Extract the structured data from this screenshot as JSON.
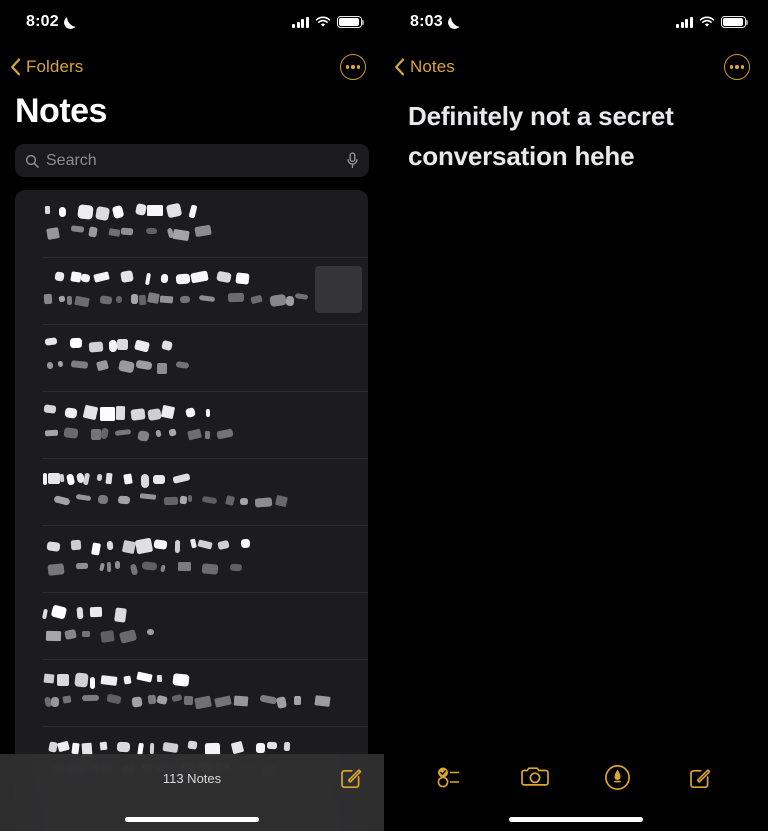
{
  "accent_color": "#dba530",
  "background_color": "#000000",
  "card_color": "#1c1c1e",
  "left_screen": {
    "status": {
      "time": "8:02",
      "moon_icon": "crescent-moon-icon",
      "signal_icon": "cellular-bars-icon",
      "wifi_icon": "wifi-icon",
      "battery_icon": "battery-full-icon"
    },
    "nav": {
      "back_label": "Folders",
      "back_icon": "chevron-left-icon",
      "more_icon": "ellipsis-circle-icon"
    },
    "title": "Notes",
    "search": {
      "placeholder": "Search",
      "icon": "magnifier-icon",
      "mic_icon": "microphone-icon"
    },
    "notes": [
      {
        "title_redacted": true,
        "preview_redacted": true,
        "has_thumbnail": false
      },
      {
        "title_redacted": true,
        "preview_redacted": true,
        "has_thumbnail": true
      },
      {
        "title_redacted": true,
        "preview_redacted": true,
        "has_thumbnail": false
      },
      {
        "title_redacted": true,
        "preview_redacted": true,
        "has_thumbnail": false
      },
      {
        "title_redacted": true,
        "preview_redacted": true,
        "has_thumbnail": false
      },
      {
        "title_redacted": true,
        "preview_redacted": true,
        "has_thumbnail": false
      },
      {
        "title_redacted": true,
        "preview_redacted": true,
        "has_thumbnail": false
      },
      {
        "title_redacted": true,
        "preview_redacted": true,
        "has_thumbnail": false
      },
      {
        "title_redacted": true,
        "preview_redacted": true,
        "has_thumbnail": false
      }
    ],
    "toolbar": {
      "count_label": "113 Notes",
      "compose_icon": "compose-icon"
    }
  },
  "right_screen": {
    "status": {
      "time": "8:03",
      "moon_icon": "crescent-moon-icon",
      "signal_icon": "cellular-bars-icon",
      "wifi_icon": "wifi-icon",
      "battery_icon": "battery-full-icon"
    },
    "nav": {
      "back_label": "Notes",
      "back_icon": "chevron-left-icon",
      "more_icon": "ellipsis-circle-icon"
    },
    "note_title": "Definitely not a secret conversation hehe",
    "toolbar": {
      "checklist_icon": "checklist-icon",
      "camera_icon": "camera-icon",
      "markup_icon": "markup-pen-circle-icon",
      "compose_icon": "compose-icon"
    }
  }
}
